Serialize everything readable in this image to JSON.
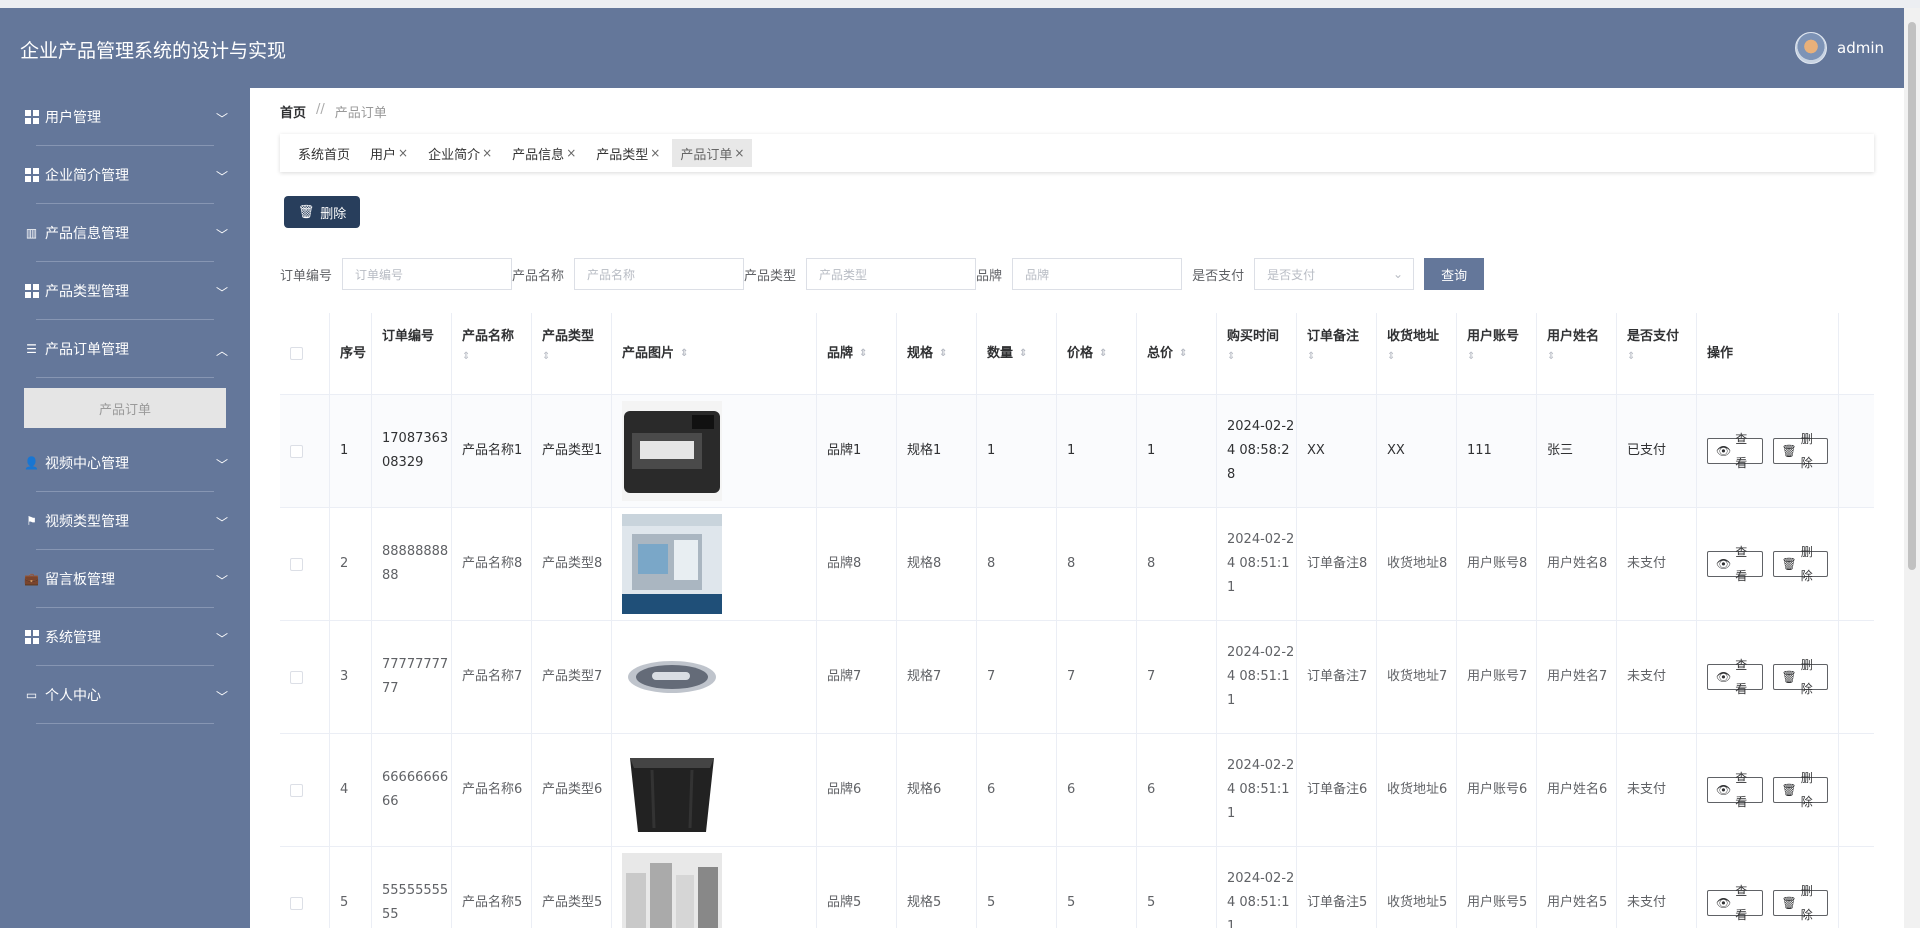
{
  "app": {
    "title": "企业产品管理系统的设计与实现",
    "user": "admin"
  },
  "sidebar": {
    "items": [
      {
        "label": "用户管理",
        "icon": "grid-icon"
      },
      {
        "label": "企业简介管理",
        "icon": "grid-icon"
      },
      {
        "label": "产品信息管理",
        "icon": "chart-icon"
      },
      {
        "label": "产品类型管理",
        "icon": "grid-icon"
      },
      {
        "label": "产品订单管理",
        "icon": "sliders-icon",
        "expanded": true,
        "sub": "产品订单"
      },
      {
        "label": "视频中心管理",
        "icon": "user-icon"
      },
      {
        "label": "视频类型管理",
        "icon": "flag-icon"
      },
      {
        "label": "留言板管理",
        "icon": "briefcase-icon"
      },
      {
        "label": "系统管理",
        "icon": "grid-icon"
      },
      {
        "label": "个人中心",
        "icon": "window-icon"
      }
    ]
  },
  "breadcrumb": {
    "home": "首页",
    "sep": "//",
    "current": "产品订单"
  },
  "tabs": [
    {
      "label": "系统首页",
      "closable": false
    },
    {
      "label": "用户",
      "closable": true
    },
    {
      "label": "企业简介",
      "closable": true
    },
    {
      "label": "产品信息",
      "closable": true
    },
    {
      "label": "产品类型",
      "closable": true
    },
    {
      "label": "产品订单",
      "closable": true,
      "active": true
    }
  ],
  "toolbar": {
    "delete_label": "删除"
  },
  "filters": {
    "order_no": {
      "label": "订单编号",
      "placeholder": "订单编号"
    },
    "product_name": {
      "label": "产品名称",
      "placeholder": "产品名称"
    },
    "product_type": {
      "label": "产品类型",
      "placeholder": "产品类型"
    },
    "brand": {
      "label": "品牌",
      "placeholder": "品牌"
    },
    "paid": {
      "label": "是否支付",
      "placeholder": "是否支付"
    },
    "query_label": "查询"
  },
  "table": {
    "headers": [
      "序号",
      "订单编号",
      "产品名称",
      "产品类型",
      "产品图片",
      "品牌",
      "规格",
      "数量",
      "价格",
      "总价",
      "购买时间",
      "订单备注",
      "收货地址",
      "用户账号",
      "用户姓名",
      "是否支付",
      "操作"
    ],
    "view_label": "查看",
    "delete_label": "删除",
    "rows": [
      {
        "idx": "1",
        "order_no": "1708736308329",
        "name": "产品名称1",
        "type": "产品类型1",
        "img": "device",
        "brand": "品牌1",
        "spec": "规格1",
        "qty": "1",
        "price": "1",
        "total": "1",
        "time": "2024-02-24 08:58:28",
        "note": "XX",
        "addr": "XX",
        "account": "111",
        "uname": "张三",
        "paid": "已支付"
      },
      {
        "idx": "2",
        "order_no": "8888888888",
        "name": "产品名称8",
        "type": "产品类型8",
        "img": "poster",
        "brand": "品牌8",
        "spec": "规格8",
        "qty": "8",
        "price": "8",
        "total": "8",
        "time": "2024-02-24 08:51:11",
        "note": "订单备注8",
        "addr": "收货地址8",
        "account": "用户账号8",
        "uname": "用户姓名8",
        "paid": "未支付"
      },
      {
        "idx": "3",
        "order_no": "7777777777",
        "name": "产品名称7",
        "type": "产品类型7",
        "img": "pod",
        "brand": "品牌7",
        "spec": "规格7",
        "qty": "7",
        "price": "7",
        "total": "7",
        "time": "2024-02-24 08:51:11",
        "note": "订单备注7",
        "addr": "收货地址7",
        "account": "用户账号7",
        "uname": "用户姓名7",
        "paid": "未支付"
      },
      {
        "idx": "4",
        "order_no": "6666666666",
        "name": "产品名称6",
        "type": "产品类型6",
        "img": "crate",
        "brand": "品牌6",
        "spec": "规格6",
        "qty": "6",
        "price": "6",
        "total": "6",
        "time": "2024-02-24 08:51:11",
        "note": "订单备注6",
        "addr": "收货地址6",
        "account": "用户账号6",
        "uname": "用户姓名6",
        "paid": "未支付"
      },
      {
        "idx": "5",
        "order_no": "5555555555",
        "name": "产品名称5",
        "type": "产品类型5",
        "img": "appliances",
        "brand": "品牌5",
        "spec": "规格5",
        "qty": "5",
        "price": "5",
        "total": "5",
        "time": "2024-02-24 08:51:11",
        "note": "订单备注5",
        "addr": "收货地址5",
        "account": "用户账号5",
        "uname": "用户姓名5",
        "paid": "未支付"
      }
    ]
  }
}
